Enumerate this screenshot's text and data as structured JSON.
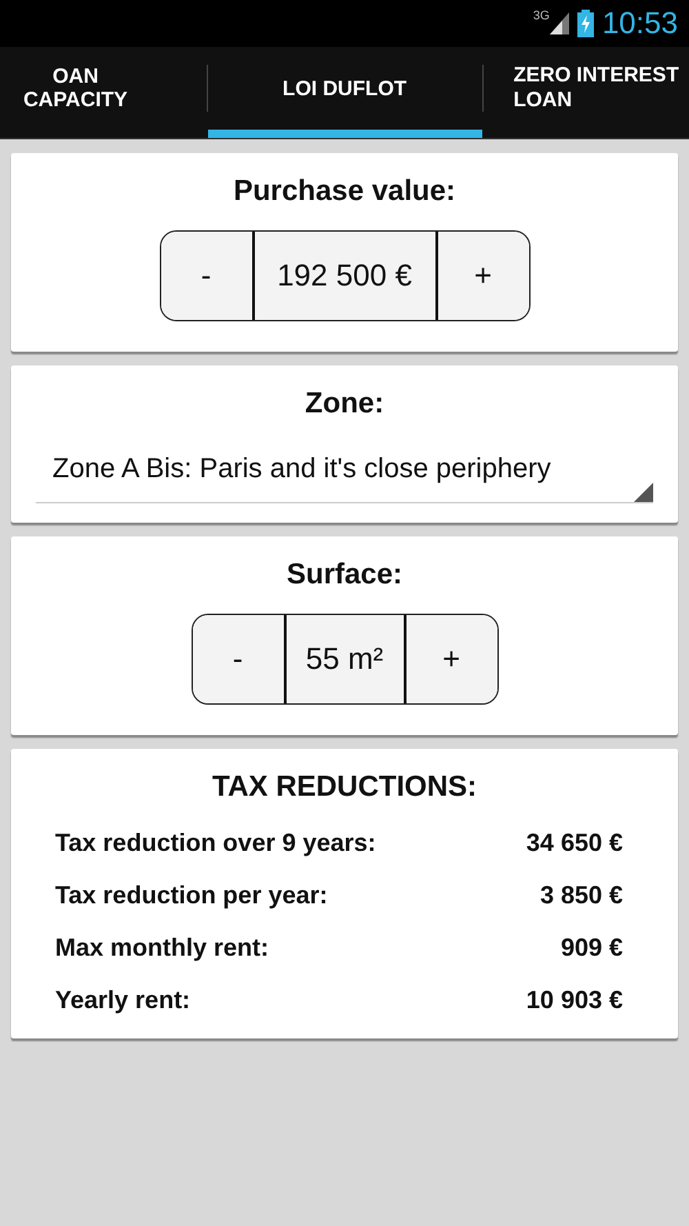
{
  "status_bar": {
    "network": "3G",
    "time": "10:53"
  },
  "tabs": [
    {
      "label": "OAN CAPACITY",
      "selected": false
    },
    {
      "label": "LOI DUFLOT",
      "selected": true
    },
    {
      "label": "ZERO INTEREST LOAN",
      "selected": false
    }
  ],
  "purchase": {
    "title": "Purchase value:",
    "minus": "-",
    "value": "192 500 €",
    "plus": "+"
  },
  "zone": {
    "title": "Zone:",
    "value": "Zone A Bis: Paris and it's close periphery"
  },
  "surface": {
    "title": "Surface:",
    "minus": "-",
    "value": "55 m²",
    "plus": "+"
  },
  "results": {
    "title": "TAX REDUCTIONS:",
    "rows": [
      {
        "label": "Tax reduction over 9 years:",
        "value": "34 650 €"
      },
      {
        "label": "Tax reduction per year:",
        "value": "3 850 €"
      },
      {
        "label": "Max monthly rent:",
        "value": "909 €"
      },
      {
        "label": "Yearly rent:",
        "value": "10 903 €"
      }
    ]
  }
}
